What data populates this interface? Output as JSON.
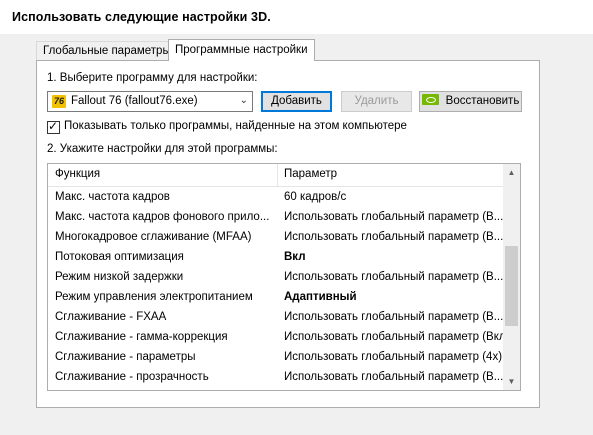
{
  "heading": "Использовать следующие настройки 3D.",
  "tabs": [
    {
      "label": "Глобальные параметры",
      "active": false
    },
    {
      "label": "Программные настройки",
      "active": true
    }
  ],
  "step1": {
    "label": "1. Выберите программу для настройки:",
    "program_icon_text": "76",
    "program_selected": "Fallout 76 (fallout76.exe)",
    "add_button": "Добавить",
    "remove_button": "Удалить",
    "restore_button": "Восстановить"
  },
  "filter": {
    "checked": true,
    "label": "Показывать только программы, найденные на этом компьютере"
  },
  "step2": {
    "label": "2. Укажите настройки для этой программы:"
  },
  "grid": {
    "columns": [
      "Функция",
      "Параметр"
    ],
    "rows": [
      {
        "feature": "Макс. частота кадров",
        "value": "60 кадров/с",
        "bold": false
      },
      {
        "feature": "Макс. частота кадров фонового прило...",
        "value": "Использовать глобальный параметр (В...",
        "bold": false
      },
      {
        "feature": "Многокадровое сглаживание (MFAA)",
        "value": "Использовать глобальный параметр (В...",
        "bold": false
      },
      {
        "feature": "Потоковая оптимизация",
        "value": "Вкл",
        "bold": true
      },
      {
        "feature": "Режим низкой задержки",
        "value": "Использовать глобальный параметр (В...",
        "bold": false
      },
      {
        "feature": "Режим управления электропитанием",
        "value": "Адаптивный",
        "bold": true
      },
      {
        "feature": "Сглаживание - FXAA",
        "value": "Использовать глобальный параметр (В...",
        "bold": false
      },
      {
        "feature": "Сглаживание - гамма-коррекция",
        "value": "Использовать глобальный параметр (Вкл)",
        "bold": false
      },
      {
        "feature": "Сглаживание - параметры",
        "value": "Использовать глобальный параметр (4x)",
        "bold": false
      },
      {
        "feature": "Сглаживание - прозрачность",
        "value": "Использовать глобальный параметр (В...",
        "bold": false
      }
    ]
  },
  "icons": {
    "combo_arrow": "chevron-down-icon",
    "scroll_up": "arrow-up-icon",
    "scroll_down": "arrow-down-icon",
    "restore_icon": "nvidia-logo-icon",
    "app_icon": "fallout76-icon"
  },
  "colors": {
    "accent": "#0078d7",
    "nvidia_green": "#76b900"
  }
}
